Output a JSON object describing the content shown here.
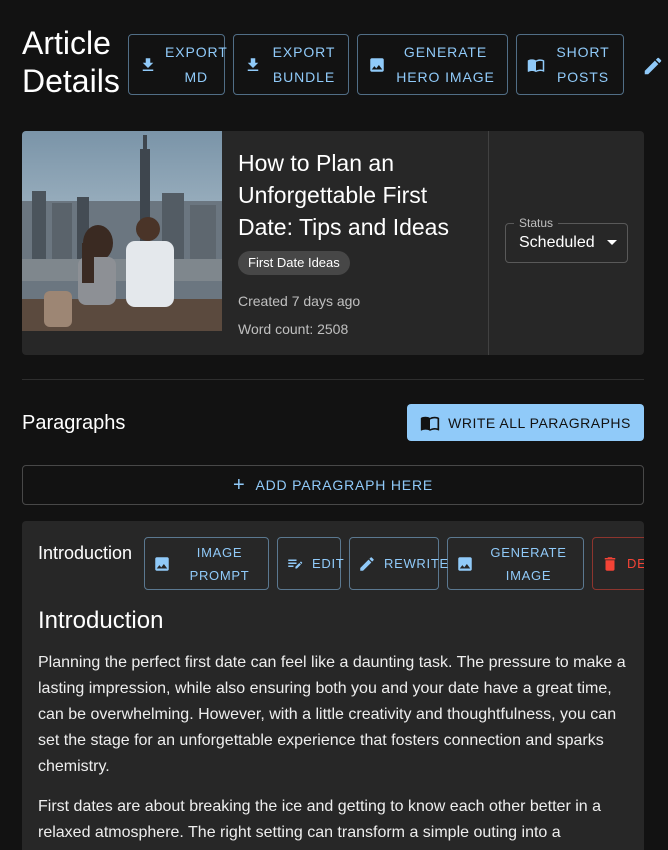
{
  "header": {
    "title": "Article Details",
    "buttons": [
      {
        "label": "Export MD",
        "icon": "download-icon"
      },
      {
        "label": "Export Bundle",
        "icon": "download-icon"
      },
      {
        "label": "Generate Hero Image",
        "icon": "image-icon"
      },
      {
        "label": "Short Posts",
        "icon": "menu-book-icon"
      }
    ],
    "edit_icon": "edit-pencil-icon"
  },
  "article": {
    "title": "How to Plan an Unforgettable First Date: Tips and Ideas",
    "category": "First Date Ideas",
    "created": "Created 7 days ago",
    "word_count": "Word count: 2508",
    "status_label": "Status",
    "status_value": "Scheduled"
  },
  "paragraphs": {
    "section_title": "Paragraphs",
    "write_all_label": "Write All Paragraphs",
    "add_label": "Add Paragraph Here",
    "items": [
      {
        "label": "Introduction",
        "actions": [
          "Image Prompt",
          "Edit",
          "Rewrite",
          "Generate Image",
          "Del"
        ],
        "heading": "Introduction",
        "body": [
          "Planning the perfect first date can feel like a daunting task. The pressure to make a lasting impression, while also ensuring both you and your date have a great time, can be overwhelming. However, with a little creativity and thoughtfulness, you can set the stage for an unforgettable experience that fosters connection and sparks chemistry.",
          "First dates are about breaking the ice and getting to know each other better in a relaxed atmosphere. The right setting can transform a simple outing into a"
        ]
      }
    ]
  },
  "colors": {
    "background": "#121212",
    "surface": "#272727",
    "primary": "#90caf9",
    "danger": "#f44336"
  }
}
